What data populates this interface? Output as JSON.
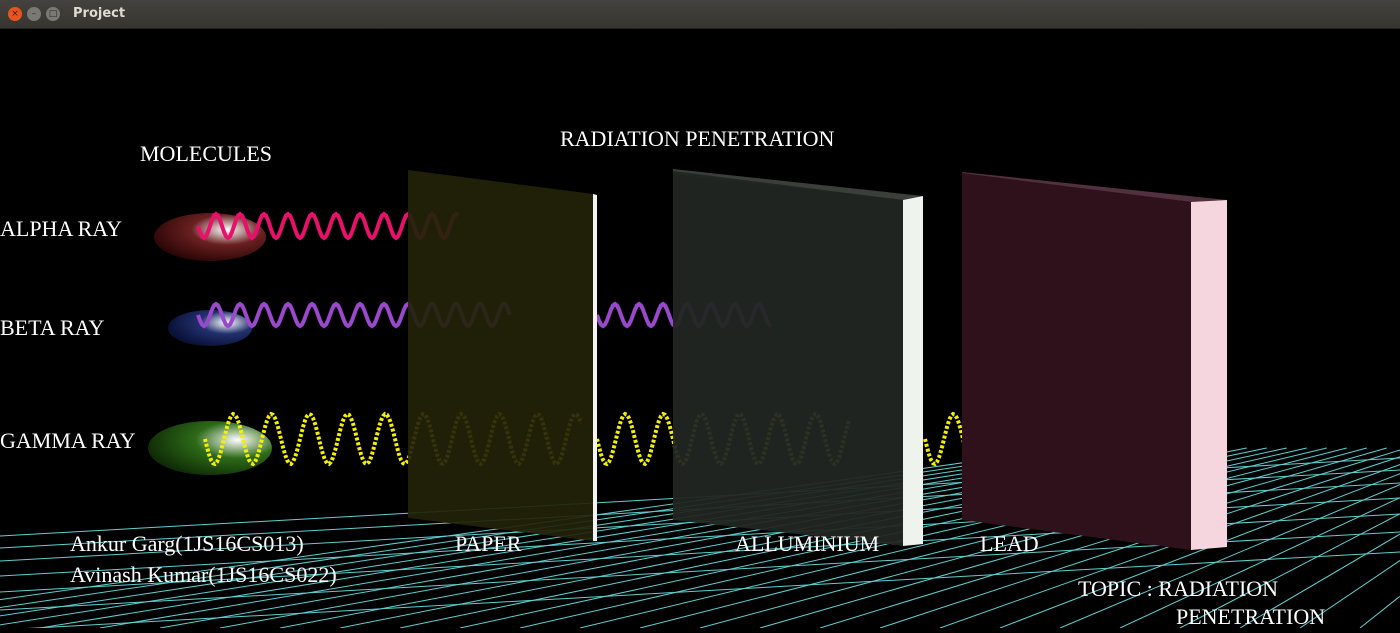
{
  "window": {
    "title": "Project",
    "close_glyph": "×",
    "min_glyph": "–",
    "max_glyph": "□"
  },
  "scene": {
    "main_title": "RADIATION PENETRATION",
    "molecules_label": "MOLECULES",
    "rays": [
      {
        "label": "ALPHA RAY",
        "color": "#e8106a",
        "molecule_color": "#4a1010"
      },
      {
        "label": "BETA RAY",
        "color": "#9a48cc",
        "molecule_color": "#16245e"
      },
      {
        "label": "GAMMA RAY",
        "color": "#f5f000",
        "molecule_color": "#1c4a0c"
      }
    ],
    "barriers": [
      {
        "label": "PAPER",
        "color": "#23230a",
        "edge_color": "#f4f4f4"
      },
      {
        "label": "ALLUMINIUM",
        "color": "#222622",
        "edge_color": "#eef3ee"
      },
      {
        "label": "LEAD",
        "color": "#2e111b",
        "edge_color": "#f5d6de"
      }
    ],
    "authors": [
      "Ankur Garg(1JS16CS013)",
      "Avinash Kumar(1JS16CS022)"
    ],
    "topic_line1": "TOPIC : RADIATION",
    "topic_line2": "PENETRATION",
    "grid_color": "#5fcfcf"
  }
}
